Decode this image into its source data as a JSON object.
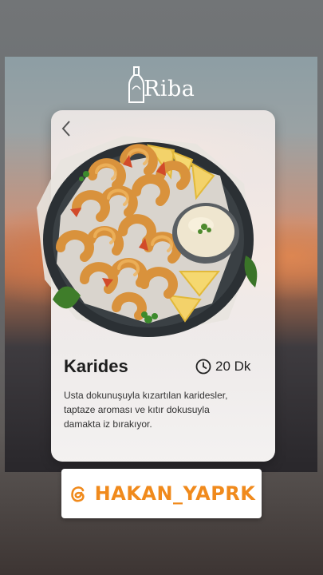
{
  "brand": {
    "name": "Riba"
  },
  "card": {
    "back_icon": "chevron-left-icon",
    "dish_name": "Karides",
    "time": "20 Dk",
    "time_icon": "clock-icon",
    "description_lines": [
      "Usta dokunuşuyla kızartılan karidesler,",
      "taptaze aroması ve kıtır dokusuyla",
      "damakta iz bırakıyor."
    ]
  },
  "handle": {
    "icon": "threads-icon",
    "text": "HAKAN_YAPRK"
  },
  "colors": {
    "accent": "#f08a1c",
    "card": "#f7f3f2",
    "title": "#1d1d1d"
  }
}
